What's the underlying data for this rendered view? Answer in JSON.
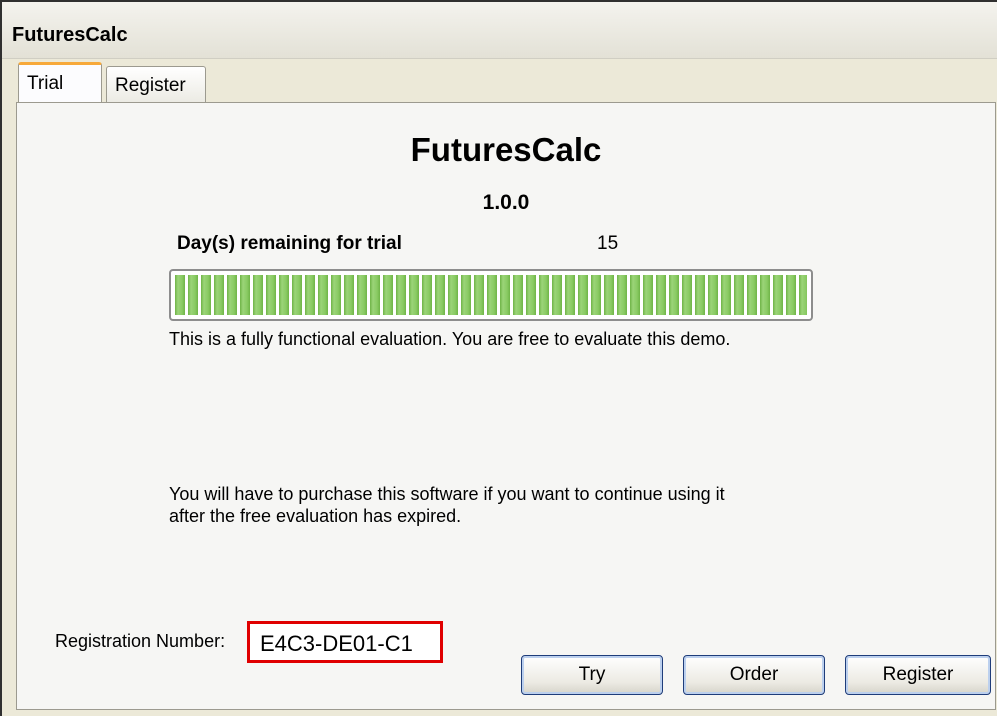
{
  "window": {
    "title": "FuturesCalc"
  },
  "tabs": [
    {
      "label": "Trial",
      "active": true
    },
    {
      "label": "Register",
      "active": false
    }
  ],
  "trial": {
    "app_name": "FuturesCalc",
    "version": "1.0.0",
    "days_label": "Day(s) remaining for trial",
    "days_remaining": "15",
    "progress_fraction": 1.0,
    "evaluation_text": "This is a fully functional evaluation. You are free to evaluate this demo.",
    "purchase_line1": "You will have to purchase this software if you want to continue using it",
    "purchase_line2": "after the free evaluation has expired.",
    "registration_label": "Registration Number:",
    "registration_number": "E4C3-DE01-C1"
  },
  "buttons": {
    "try": "Try",
    "order": "Order",
    "register": "Register"
  },
  "colors": {
    "progress_green": "#6fb447",
    "active_tab_accent": "#f7a93a",
    "highlight_box": "#e00000"
  }
}
